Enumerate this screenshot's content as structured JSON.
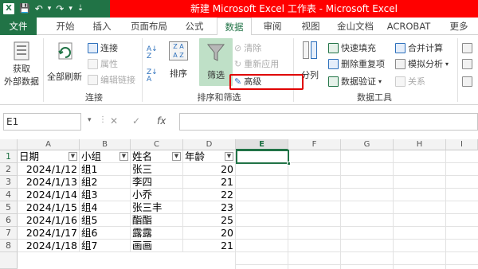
{
  "window": {
    "title": "新建 Microsoft Excel 工作表 - Microsoft Excel"
  },
  "qat": {
    "save": "💾",
    "undo": "↶",
    "undo_dd": "▾",
    "redo": "↷",
    "redo_dd": "▾",
    "custom": "⇣"
  },
  "tabs": [
    "文件",
    "开始",
    "插入",
    "页面布局",
    "公式",
    "数据",
    "审阅",
    "视图",
    "金山文档",
    "ACROBAT",
    "更多"
  ],
  "ribbon": {
    "get_external": "获取\n外部数据",
    "get_external_l1": "获取",
    "get_external_l2": "外部数据",
    "refresh_all": "全部刷新",
    "conn_connect": "连接",
    "conn_props": "属性",
    "conn_edit_links": "编辑链接",
    "group_connections": "连接",
    "sort": "排序",
    "filter": "筛选",
    "clear": "清除",
    "reapply": "重新应用",
    "advanced": "高级",
    "group_sort_filter": "排序和筛选",
    "text_to_columns": "分列",
    "flash_fill": "快速填充",
    "remove_dup": "删除重复项",
    "data_validation": "数据验证",
    "consolidate": "合并计算",
    "what_if": "模拟分析",
    "relationships": "关系",
    "group_data_tools": "数据工具"
  },
  "formula": {
    "name_box": "E1",
    "fx": "fx",
    "cancel": "✕",
    "enter": "✓",
    "value": ""
  },
  "columns": [
    "A",
    "B",
    "C",
    "D",
    "E",
    "F",
    "G",
    "H",
    "I"
  ],
  "headers": [
    "日期",
    "小组",
    "姓名",
    "年龄"
  ],
  "rows": [
    {
      "n": "1"
    },
    {
      "n": "2",
      "date": "2024/1/12",
      "group": "组1",
      "name": "张三",
      "age": "20"
    },
    {
      "n": "3",
      "date": "2024/1/13",
      "group": "组2",
      "name": "李四",
      "age": "21"
    },
    {
      "n": "4",
      "date": "2024/1/14",
      "group": "组3",
      "name": "小乔",
      "age": "22"
    },
    {
      "n": "5",
      "date": "2024/1/15",
      "group": "组4",
      "name": "张三丰",
      "age": "23"
    },
    {
      "n": "6",
      "date": "2024/1/16",
      "group": "组5",
      "name": "酯酯",
      "age": "25"
    },
    {
      "n": "7",
      "date": "2024/1/17",
      "group": "组6",
      "name": "露露",
      "age": "20"
    },
    {
      "n": "8",
      "date": "2024/1/18",
      "group": "组7",
      "name": "画画",
      "age": "21"
    }
  ],
  "colors": {
    "excel_green": "#217346",
    "title_highlight": "#ff0000",
    "advanced_box": "#e00000"
  }
}
